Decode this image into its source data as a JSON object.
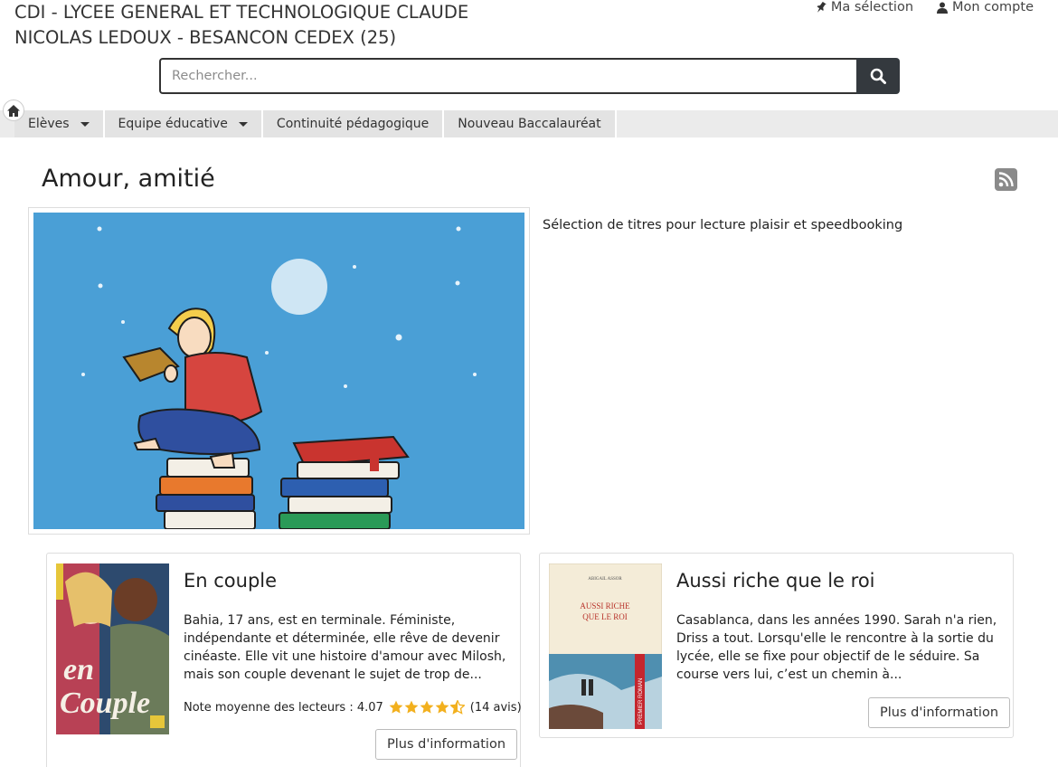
{
  "header": {
    "site_title": "CDI - LYCEE GENERAL ET TECHNOLOGIQUE CLAUDE NICOLAS LEDOUX - BESANCON CEDEX (25)",
    "my_selection_label": "Ma sélection",
    "my_account_label": "Mon compte"
  },
  "search": {
    "placeholder": "Rechercher..."
  },
  "nav": {
    "items": [
      {
        "label": "Elèves",
        "dropdown": true
      },
      {
        "label": "Equipe éducative",
        "dropdown": true
      },
      {
        "label": "Continuité pédagogique",
        "dropdown": false
      },
      {
        "label": "Nouveau Baccalauréat",
        "dropdown": false
      }
    ]
  },
  "page": {
    "title": "Amour, amitié",
    "description": "Sélection de titres pour lecture plaisir et speedbooking"
  },
  "books": [
    {
      "title": "En couple",
      "summary": "Bahia, 17 ans, est en terminale. Féministe, indépendante et déterminée, elle rêve de devenir cinéaste. Elle vit une histoire d'amour avec Milosh, mais son couple devenant le sujet de trop de...",
      "rating_label": "Note moyenne des lecteurs : 4.07",
      "rating_value": 4.07,
      "reviews": "(14 avis)",
      "cover_text": "en Couple",
      "more_label": "Plus d'information"
    },
    {
      "title": "Aussi riche que le roi",
      "summary": "Casablanca, dans les années 1990. Sarah n'a rien, Driss a tout. Lorsqu'elle le rencontre à la sortie du lycée, elle se fixe pour objectif de le séduire. Sa course vers lui, c’est un chemin à...",
      "cover_title": "AUSSI RICHE QUE LE ROI",
      "cover_author": "ABIGAIL ASSOR",
      "cover_band": "PREMIER ROMAN",
      "more_label": "Plus d'information"
    }
  ],
  "colors": {
    "accent_dark": "#34393e",
    "nav_bg": "#ebebeb",
    "star": "#f2b01e",
    "hero_sky": "#4a9fd6"
  }
}
